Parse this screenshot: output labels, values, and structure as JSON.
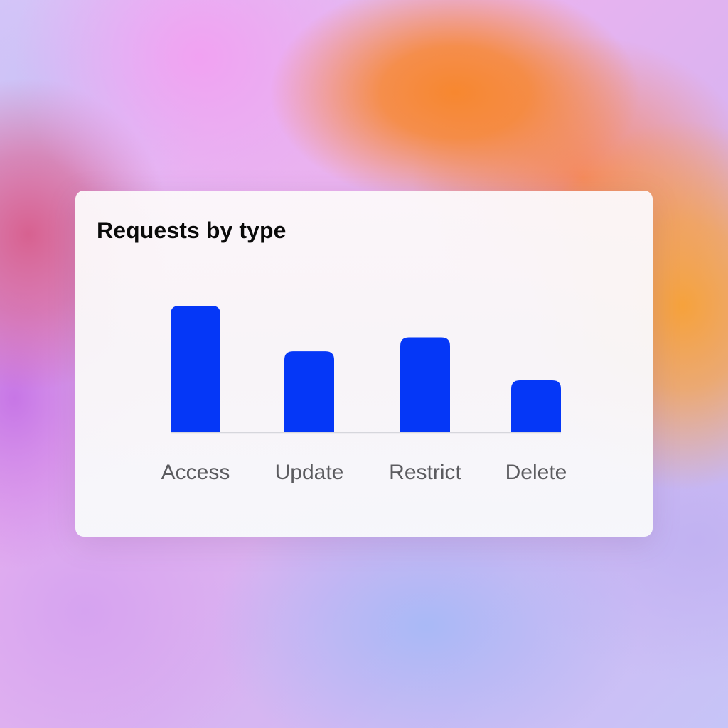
{
  "card": {
    "title": "Requests by type"
  },
  "chart_data": {
    "type": "bar",
    "title": "Requests by type",
    "categories": [
      "Access",
      "Update",
      "Restrict",
      "Delete"
    ],
    "values": [
      100,
      64,
      75,
      41
    ],
    "ylim": [
      0,
      100
    ],
    "grid": false,
    "xlabel": "",
    "ylabel": "",
    "bar_color": "#0537f7",
    "baseline_color": "#d6d6dc",
    "label_color": "#5b5b5f"
  }
}
